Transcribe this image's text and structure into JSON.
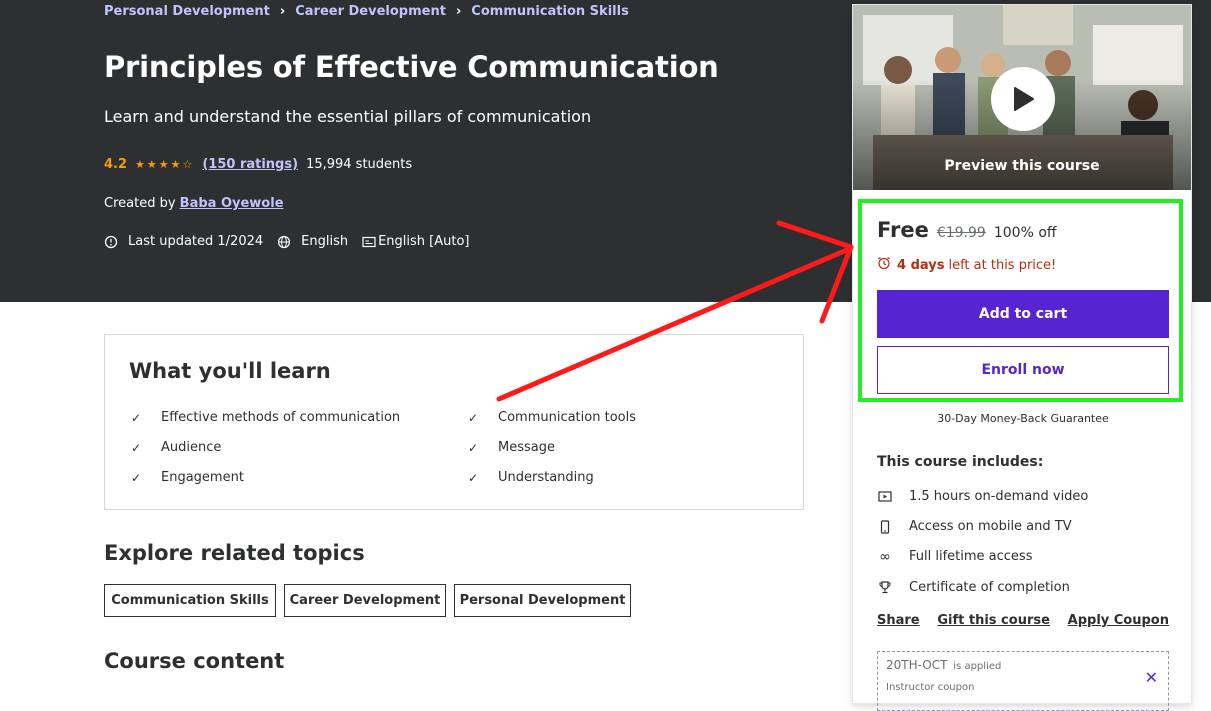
{
  "breadcrumb": [
    "Personal Development",
    "Career Development",
    "Communication Skills"
  ],
  "course": {
    "title": "Principles of Effective Communication",
    "subtitle": "Learn and understand the essential pillars of communication",
    "rating": "4.2",
    "stars": 4.2,
    "ratings_link": "(150 ratings)",
    "students": "15,994 students",
    "created_by_label": "Created by",
    "instructor": "Baba Oyewole",
    "last_updated": "Last updated 1/2024",
    "language": "English",
    "captions": "English [Auto]"
  },
  "learn": {
    "title": "What you'll learn",
    "items": [
      "Effective methods of communication",
      "Communication tools",
      "Audience",
      "Message",
      "Engagement",
      "Understanding"
    ]
  },
  "explore": {
    "title": "Explore related topics",
    "topics": [
      "Communication Skills",
      "Career Development",
      "Personal Development"
    ]
  },
  "content_title": "Course content",
  "sidebar": {
    "preview_label": "Preview this course",
    "price": "Free",
    "original_price": "€19.99",
    "discount": "100% off",
    "timer_days": "4 days",
    "timer_text": "left at this price!",
    "add_to_cart": "Add to cart",
    "enroll_now": "Enroll now",
    "guarantee": "30-Day Money-Back Guarantee",
    "includes_title": "This course includes:",
    "includes": [
      "1.5 hours on-demand video",
      "Access on mobile and TV",
      "Full lifetime access",
      "Certificate of completion"
    ],
    "share": "Share",
    "gift": "Gift this course",
    "apply_coupon": "Apply Coupon",
    "coupon_code": "20TH-OCT",
    "coupon_applied": "is applied",
    "coupon_type": "Instructor coupon"
  },
  "colors": {
    "hero_bg": "#2d2f31",
    "accent_purple": "#5624d0",
    "star_orange": "#f69c08",
    "link_lavender": "#c0c4fc",
    "timer_red": "#b32d0f",
    "highlight_green": "#22ee22",
    "arrow_red": "#ff1a1a"
  }
}
